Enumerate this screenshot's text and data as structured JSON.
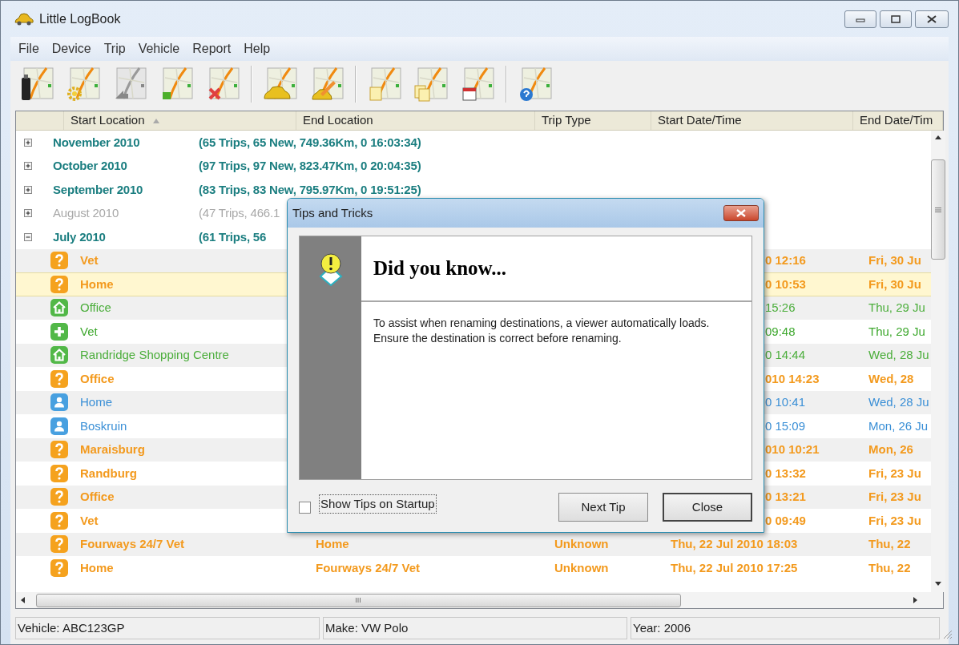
{
  "window": {
    "title": "Little LogBook"
  },
  "menu": [
    "File",
    "Device",
    "Trip",
    "Vehicle",
    "Report",
    "Help"
  ],
  "table": {
    "columns": [
      {
        "label": "Start Location",
        "sorted": true
      },
      {
        "label": "End Location",
        "sorted": false
      },
      {
        "label": "Trip Type",
        "sorted": false
      },
      {
        "label": "Start Date/Time",
        "sorted": false
      },
      {
        "label": "End Date/Tim",
        "sorted": false
      }
    ],
    "rows": [
      {
        "kind": "group",
        "label": "November 2010",
        "summary": "(65 Trips, 65 New, 749.36Km, 0 16:03:34)",
        "expanded": false,
        "disabled": false
      },
      {
        "kind": "group",
        "label": "October 2010",
        "summary": "(97 Trips, 97 New, 823.47Km, 0 20:04:35)",
        "expanded": false,
        "disabled": false
      },
      {
        "kind": "group",
        "label": "September 2010",
        "summary": "(83 Trips, 83 New, 795.97Km, 0 19:51:25)",
        "expanded": false,
        "disabled": false
      },
      {
        "kind": "group",
        "label": "August 2010",
        "summary": "(47 Trips, 466.1",
        "expanded": false,
        "disabled": true
      },
      {
        "kind": "group",
        "label": "July 2010",
        "summary": "(61 Trips, 56",
        "expanded": true,
        "disabled": false
      },
      {
        "kind": "unknown",
        "selected": false,
        "start_location": "Vet",
        "start_date_time": "0 12:16",
        "end_date_time": "Fri, 30 Ju"
      },
      {
        "kind": "unknown",
        "selected": true,
        "start_location": "Home",
        "start_date_time": "0 10:53",
        "end_date_time": "Fri, 30 Ju"
      },
      {
        "kind": "home",
        "selected": false,
        "start_location": "Office",
        "start_date_time": "15:26",
        "end_date_time": "Thu, 29 Ju"
      },
      {
        "kind": "medical",
        "selected": false,
        "start_location": "Vet",
        "start_date_time": "09:48",
        "end_date_time": "Thu, 29 Ju"
      },
      {
        "kind": "home",
        "selected": false,
        "start_location": "Randridge Shopping Centre",
        "start_date_time": "0 14:44",
        "end_date_time": "Wed, 28 Ju"
      },
      {
        "kind": "unknown",
        "selected": false,
        "start_location": "Office",
        "start_date_time": "010 14:23",
        "end_date_time": "Wed, 28"
      },
      {
        "kind": "person",
        "selected": false,
        "start_location": "Home",
        "start_date_time": "0 10:41",
        "end_date_time": "Wed, 28 Ju"
      },
      {
        "kind": "person",
        "selected": false,
        "start_location": "Boskruin",
        "start_date_time": "0 15:09",
        "end_date_time": "Mon, 26 Ju"
      },
      {
        "kind": "unknown",
        "selected": false,
        "start_location": "Maraisburg",
        "start_date_time": "010 10:21",
        "end_date_time": "Mon, 26"
      },
      {
        "kind": "unknown",
        "selected": false,
        "start_location": "Randburg",
        "start_date_time": "0 13:32",
        "end_date_time": "Fri, 23 Ju"
      },
      {
        "kind": "unknown",
        "selected": false,
        "start_location": "Office",
        "start_date_time": "0 13:21",
        "end_date_time": "Fri, 23 Ju"
      },
      {
        "kind": "unknown",
        "selected": false,
        "start_location": "Vet",
        "start_date_time": "0 09:49",
        "end_date_time": "Fri, 23 Ju"
      },
      {
        "kind": "unknown",
        "selected": false,
        "start_location": "Fourways 24/7 Vet",
        "end_location": "Home",
        "trip_type": "Unknown",
        "start_date_time": "Thu, 22 Jul 2010 18:03",
        "end_date_time": "Thu, 22"
      },
      {
        "kind": "unknown",
        "selected": false,
        "start_location": "Home",
        "end_location": "Fourways 24/7 Vet",
        "trip_type": "Unknown",
        "start_date_time": "Thu, 22 Jul 2010 17:25",
        "end_date_time": "Thu, 22"
      }
    ]
  },
  "dialog": {
    "title": "Tips and Tricks",
    "heading": "Did you know...",
    "tip": "To assist when renaming destinations, a viewer automatically loads. Ensure the destination is correct before renaming.",
    "show_tips": {
      "label": "Show Tips on Startup",
      "checked": false
    },
    "buttons": [
      {
        "label": "Next Tip",
        "default": false
      },
      {
        "label": "Close",
        "default": true
      }
    ]
  },
  "status_bar": [
    "Vehicle: ABC123GP",
    "Make: VW Polo",
    "Year: 2006"
  ]
}
